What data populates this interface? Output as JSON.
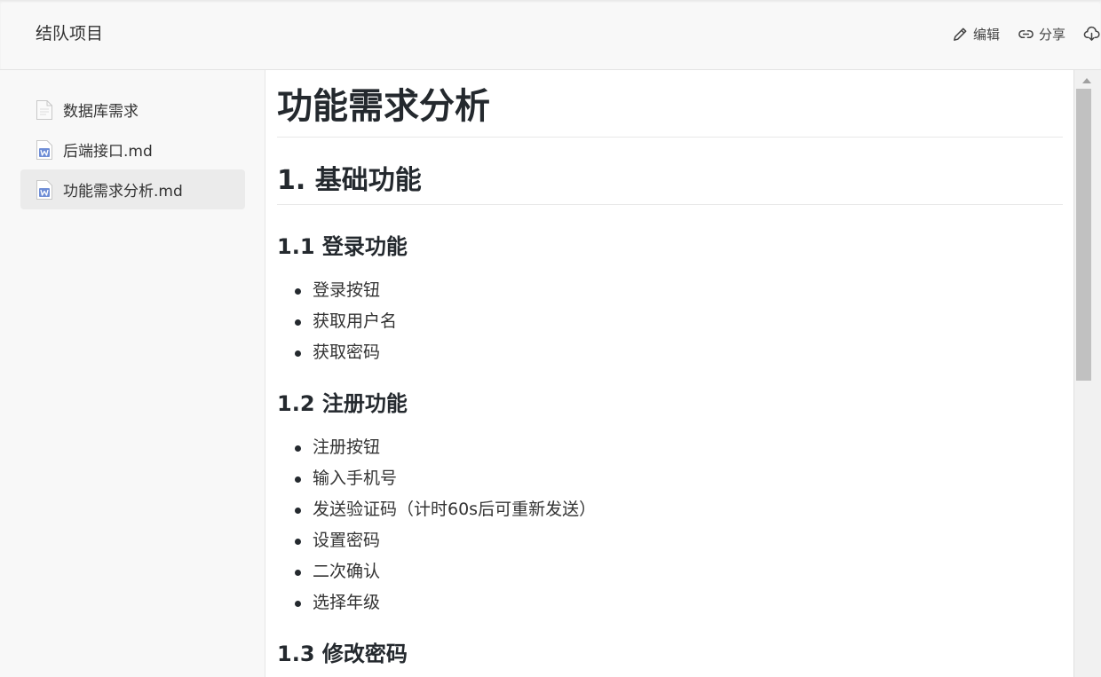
{
  "header": {
    "project_title": "结队项目",
    "actions": [
      {
        "label": "编辑",
        "icon": "edit-icon"
      },
      {
        "label": "分享",
        "icon": "link-icon"
      },
      {
        "label": "",
        "icon": "cloud-download-icon"
      }
    ]
  },
  "sidebar": {
    "files": [
      {
        "label": "数据库需求",
        "icon": "document-icon",
        "active": false
      },
      {
        "label": "后端接口.md",
        "icon": "word-document-icon",
        "active": false
      },
      {
        "label": "功能需求分析.md",
        "icon": "word-document-icon",
        "active": true
      }
    ]
  },
  "document": {
    "title": "功能需求分析",
    "section1": {
      "heading": "1. 基础功能",
      "sub1": {
        "heading": "1.1 登录功能",
        "items": [
          "登录按钮",
          "获取用户名",
          "获取密码"
        ]
      },
      "sub2": {
        "heading": "1.2 注册功能",
        "items": [
          "注册按钮",
          "输入手机号",
          "发送验证码（计时60s后可重新发送）",
          "设置密码",
          "二次确认",
          "选择年级"
        ]
      },
      "sub3": {
        "heading": "1.3 修改密码"
      }
    }
  },
  "colors": {
    "topbar_bg": "#f8f8f8",
    "sidebar_bg": "#f8f8f8",
    "active_item_bg": "#ebebeb",
    "text_primary": "#24292e",
    "word_icon_blue": "#6f8ed6"
  }
}
